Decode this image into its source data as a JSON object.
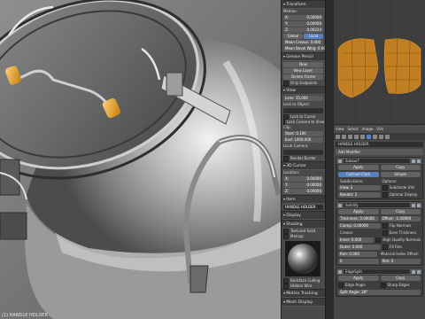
{
  "viewport": {
    "label": "(1) HANDLE HOLDER"
  },
  "npanel": {
    "transform_title": "Transform",
    "median_label": "Median:",
    "median": [
      {
        "axis": "X:",
        "value": "0.00000"
      },
      {
        "axis": "Y:",
        "value": "0.00000"
      },
      {
        "axis": "Z:",
        "value": "0.00224"
      }
    ],
    "global_label": "Global",
    "local_label": "Local",
    "mean_crease": "Mean Crease: 0.000",
    "mean_bevel": "Mean Bevel Weig: 0.000",
    "grease_pencil_title": "Grease Pencil",
    "new_label": "New",
    "new_layer_label": "New Layer",
    "delete_frame_label": "Delete Frame",
    "only_endpoints_label": "Only Endpoints",
    "view_title": "View",
    "lens": "Lens: 35.000",
    "lock_to_object_label": "Lock to Object:",
    "lock_to_cursor_label": "Lock to Cursor",
    "lock_camera_label": "Lock Camera to View",
    "clip_label": "Clip:",
    "clip_start": "Start: 0.100",
    "clip_end": "End: 1000.000",
    "local_camera_label": "Local Camera:",
    "render_border_label": "Render Border",
    "cursor_title": "3D Cursor",
    "location_label": "Location:",
    "cursor": [
      {
        "axis": "X:",
        "value": "0.00000"
      },
      {
        "axis": "Y:",
        "value": "0.00000"
      },
      {
        "axis": "Z:",
        "value": "0.00000"
      }
    ],
    "item_title": "Item",
    "item_name": "HANDLE HOLDER",
    "display_title": "Display",
    "shading_title": "Shading",
    "textured_solid_label": "Textured Solid",
    "matcap_label": "Matcap",
    "backface_culling_label": "Backface Culling",
    "hidden_wire_label": "Hidden Wire",
    "motion_tracking_title": "Motion Tracking",
    "mesh_display_title": "Mesh Display"
  },
  "uv_header": {
    "items": [
      "View",
      "Select",
      "Image",
      "UVs"
    ]
  },
  "props": {
    "object_name": "HANDLE HOLDER",
    "add_modifier_label": "Add Modifier",
    "subsurf": {
      "name": "Subsurf",
      "apply_label": "Apply",
      "copy_label": "Copy",
      "catmull_label": "Catmull-Clark",
      "simple_label": "Simple",
      "subdivisions_label": "Subdivisions:",
      "options_label": "Options:",
      "view_field": "View: 2",
      "render_field": "Render: 2",
      "subdivide_uvs_label": "Subdivide UVs",
      "optimal_display_label": "Optimal Display"
    },
    "solidify": {
      "name": "Solidify",
      "apply_label": "Apply",
      "copy_label": "Copy",
      "thickness": "Thickness: 0.00000",
      "offset": "Offset: -1.00000",
      "clamp": "Clamp: 0.00000",
      "flip_normals_label": "Flip Normals",
      "even_thickness_label": "Even Thickness",
      "high_quality_normals_label": "High Quality Normals",
      "fill_rim_label": "Fill Rim",
      "crease_label": "Crease:",
      "inner": "Inner: 0.000",
      "outer": "Outer: 0.000",
      "rim": "Rim: 0.000",
      "material_index_label": "Material Index Offset:",
      "mat_offset": "0",
      "rim_offset": "Rim: 0"
    },
    "edgesplit": {
      "name": "EdgeSplit",
      "apply_label": "Apply",
      "copy_label": "Copy",
      "edge_angle_label": "Edge Angle",
      "sharp_edges_label": "Sharp Edges",
      "split_angle": "Split Angle: 30°"
    }
  }
}
